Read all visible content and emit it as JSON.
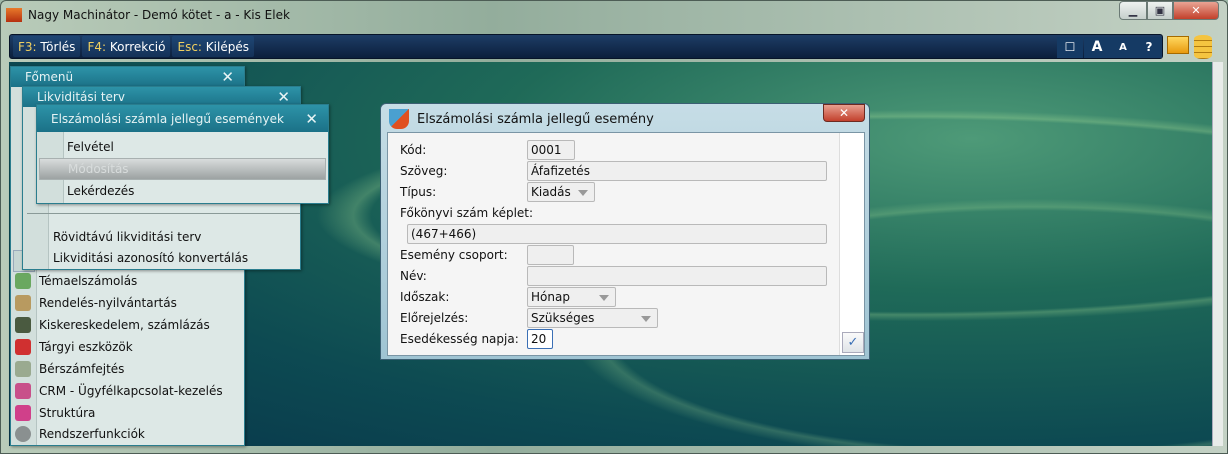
{
  "window": {
    "title": "Nagy Machinátor - Demó kötet - a - Kis Elek",
    "app_icon_text": "NM"
  },
  "toolbar": {
    "items": [
      {
        "key": "F3:",
        "label": "Törlés"
      },
      {
        "key": "F4:",
        "label": "Korrekció"
      },
      {
        "key": "Esc:",
        "label": "Kilépés"
      }
    ],
    "right_buttons": [
      "☐",
      "A",
      "A",
      "?"
    ]
  },
  "main_menu": {
    "title": "Főmenü",
    "items": [
      "Témaelszámolás",
      "Rendelés-nyilvántartás",
      "Kiskereskedelem, számlázás",
      "Tárgyi eszközök",
      "Bérszámfejtés",
      "CRM - Ügyfélkapcsolat-kezelés",
      "Struktúra",
      "Rendszerfunkciók"
    ]
  },
  "liquidity_menu": {
    "title": "Likviditási terv",
    "items": [
      "Rövidtávú likviditási terv",
      "Likviditási azonosító konvertálás"
    ]
  },
  "events_menu": {
    "title": "Elszámolási számla jellegű események",
    "items": [
      "Felvétel",
      "Módosítás",
      "Lekérdezés"
    ],
    "selected": "Módosítás"
  },
  "dialog": {
    "title": "Elszámolási számla jellegű esemény",
    "fields": {
      "kod": {
        "label": "Kód:",
        "value": "0001"
      },
      "szoveg": {
        "label": "Szöveg:",
        "value": "Áfafizetés"
      },
      "tipus": {
        "label": "Típus:",
        "value": "Kiadás"
      },
      "fokonyvi": {
        "label": "Főkönyvi szám képlet:",
        "value": "(467+466)"
      },
      "csoport": {
        "label": "Esemény csoport:",
        "value": ""
      },
      "nev": {
        "label": "Név:",
        "value": ""
      },
      "idoszak": {
        "label": "Időszak:",
        "value": "Hónap"
      },
      "elorejelzes": {
        "label": "Előrejelzés:",
        "value": "Szükséges"
      },
      "esedekesseg": {
        "label": "Esedékesség napja:",
        "value": "20"
      }
    }
  },
  "colors": {
    "toolbar": "#0b1f3c",
    "panel_header": "#1b7187",
    "key_hint": "#f0d060"
  }
}
